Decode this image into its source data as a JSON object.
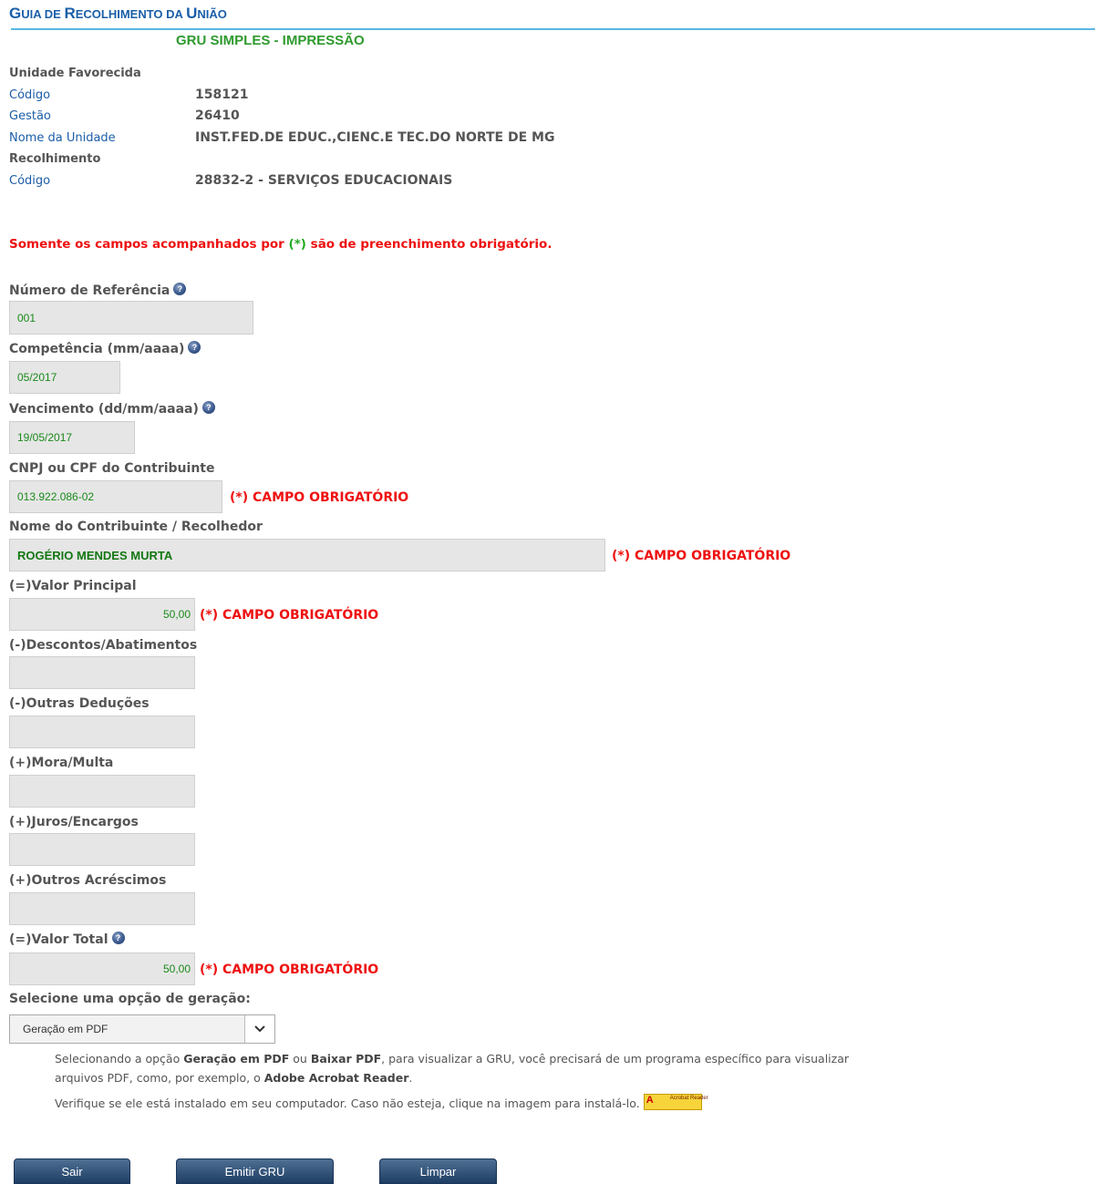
{
  "header": {
    "title_g": "G",
    "title_1": "UIA DE ",
    "title_r": "R",
    "title_2": "ECOLHIMENTO DA ",
    "title_u": "U",
    "title_3": "NIÃO",
    "subtitle": "GRU SIMPLES - IMPRESSÃO"
  },
  "unit": {
    "section_label": "Unidade Favorecida",
    "code_label": "Código",
    "code_value": "158121",
    "gestao_label": "Gestão",
    "gestao_value": "26410",
    "name_label": "Nome da Unidade",
    "name_value": "INST.FED.DE EDUC.,CIENC.E TEC.DO NORTE DE MG"
  },
  "collection": {
    "section_label": "Recolhimento",
    "code_label": "Código",
    "code_value": "28832-2 - SERVIÇOS EDUCACIONAIS"
  },
  "notice": {
    "before": "Somente os campos acompanhados por ",
    "asterisk": "(*)",
    "after": " são de preenchimento obrigatório."
  },
  "form": {
    "help_symbol": "?",
    "required_text": "(*) CAMPO OBRIGATÓRIO",
    "ref_label": "Número de Referência",
    "ref_value": "001",
    "competencia_label": "Competência (mm/aaaa)",
    "competencia_value": "05/2017",
    "vencimento_label": "Vencimento (dd/mm/aaaa)",
    "vencimento_value": "19/05/2017",
    "cpf_label": "CNPJ ou CPF do Contribuinte",
    "cpf_value": "013.922.086-02",
    "nome_label": "Nome do Contribuinte / Recolhedor",
    "nome_value": "ROGÉRIO MENDES MURTA",
    "principal_label": "(=)Valor Principal",
    "principal_value": "50,00",
    "descontos_label": "(-)Descontos/Abatimentos",
    "descontos_value": "",
    "deducoes_label": "(-)Outras Deduções",
    "deducoes_value": "",
    "mora_label": "(+)Mora/Multa",
    "mora_value": "",
    "juros_label": "(+)Juros/Encargos",
    "juros_value": "",
    "acrescimos_label": "(+)Outros Acréscimos",
    "acrescimos_value": "",
    "total_label": "(=)Valor Total",
    "total_value": "50,00",
    "generation_label": "Selecione uma opção de geração:",
    "generation_selected": "Geração em PDF"
  },
  "pdf_note": {
    "line1_a": "Selecionando a opção ",
    "line1_b": "Geração em PDF",
    "line1_c": " ou ",
    "line1_d": "Baixar PDF",
    "line1_e": ", para visualizar a GRU, você precisará de um programa específico para visualizar",
    "line2_a": "arquivos PDF, como, por exemplo, o ",
    "line2_b": "Adobe Acrobat Reader",
    "line2_c": ".",
    "line3": "Verifique se ele está instalado em seu computador. Caso não esteja, clique na imagem para instalá-lo.",
    "badge_logo": "A",
    "badge_text": "Acrobat Reader"
  },
  "buttons": {
    "exit": "Sair",
    "emit": "Emitir GRU",
    "clear": "Limpar"
  },
  "colors": {
    "title_blue": "#1a5ea8",
    "subtitle_green": "#2e9a2e",
    "required_red": "#ee1111",
    "button_navy": "#1d3d63"
  }
}
